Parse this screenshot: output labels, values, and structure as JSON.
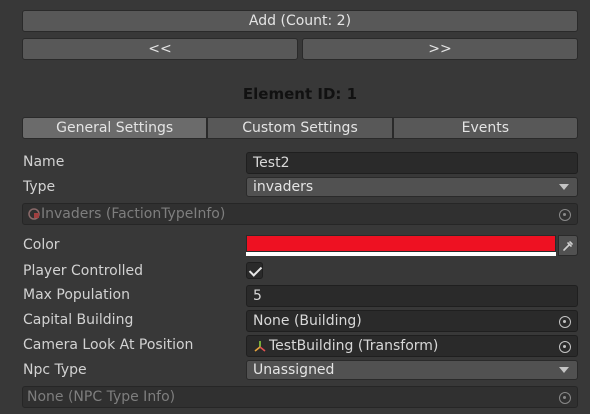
{
  "toolbar": {
    "add_label": "Add (Count: 2)",
    "prev_label": "<<",
    "next_label": ">>"
  },
  "element_title": "Element ID: 1",
  "tabs": [
    {
      "label": "General Settings",
      "active": true
    },
    {
      "label": "Custom Settings",
      "active": false
    },
    {
      "label": "Events",
      "active": false
    }
  ],
  "fields": {
    "name": {
      "label": "Name",
      "value": "Test2"
    },
    "type": {
      "label": "Type",
      "value": "invaders"
    },
    "type_info": {
      "value": "Invaders (FactionTypeInfo)"
    },
    "color": {
      "label": "Color",
      "value": "#ee1122"
    },
    "player_controlled": {
      "label": "Player Controlled",
      "checked": true
    },
    "max_population": {
      "label": "Max Population",
      "value": "5"
    },
    "capital_building": {
      "label": "Capital Building",
      "value": "None (Building)"
    },
    "camera_look_at": {
      "label": "Camera Look At Position",
      "value": "TestBuilding (Transform)"
    },
    "npc_type": {
      "label": "Npc Type",
      "value": "Unassigned"
    },
    "npc_type_info": {
      "value": "None (NPC Type Info)"
    }
  },
  "icons": [
    "eyedropper-icon",
    "object-picker-icon",
    "dropdown-caret-icon",
    "checkmark-icon",
    "transform-icon",
    "scriptable-object-icon"
  ]
}
